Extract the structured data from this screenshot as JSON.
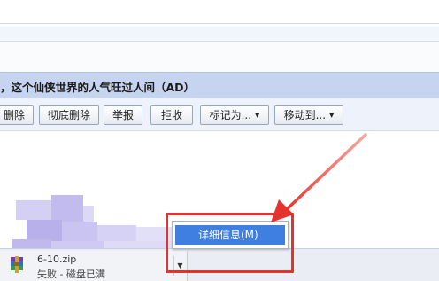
{
  "mail": {
    "subject": "，这个仙侠世界的人气旺过人间（AD）"
  },
  "toolbar": {
    "buttons": [
      {
        "label": "删除",
        "has_dropdown": false
      },
      {
        "label": "彻底删除",
        "has_dropdown": false
      },
      {
        "label": "举报",
        "has_dropdown": false
      },
      {
        "label": "拒收",
        "has_dropdown": false
      },
      {
        "label": "标记为...",
        "has_dropdown": true
      },
      {
        "label": "移动到...",
        "has_dropdown": true
      }
    ]
  },
  "download": {
    "file_name": "6-10.zip",
    "status": "失败 - 磁盘已满",
    "icon": "winrar-archive-icon",
    "dropdown_icon": "chevron-down-icon"
  },
  "context_menu": {
    "items": [
      {
        "label": "详细信息(M)",
        "highlighted": true
      }
    ]
  },
  "colors": {
    "subject_bar": "#c6d4f0",
    "menu_highlight": "#3f7fe0",
    "annotation_red": "#e5322d"
  }
}
